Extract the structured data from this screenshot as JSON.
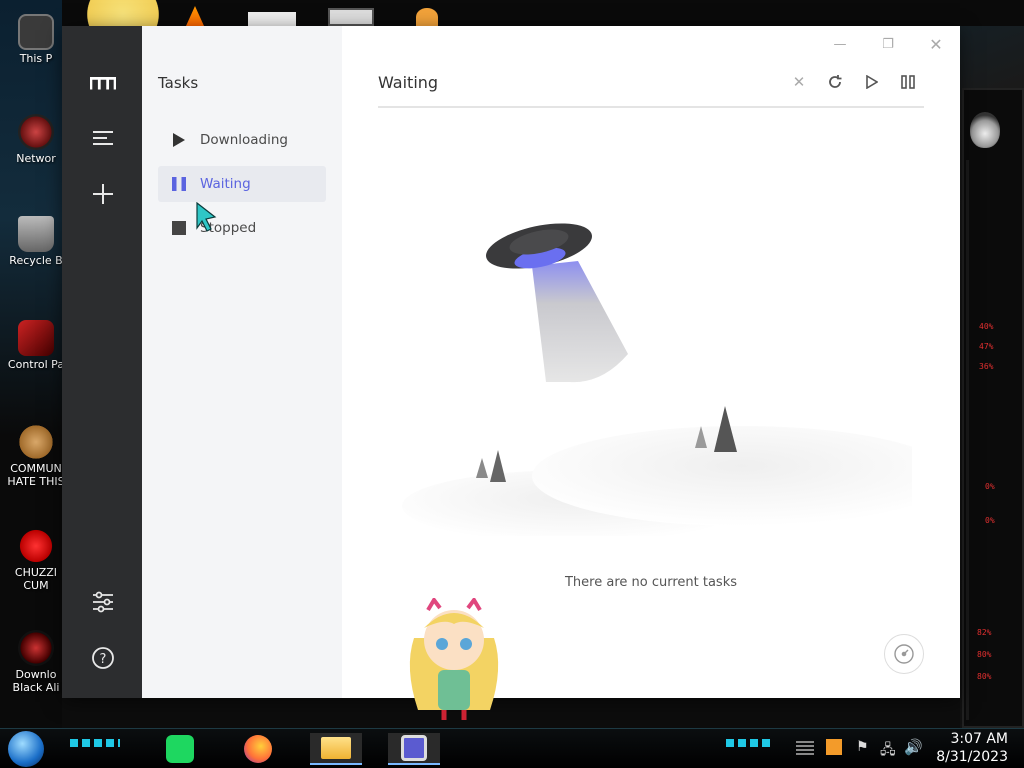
{
  "desktop": {
    "icons": [
      {
        "label": "This P",
        "icon": "computer-icon"
      },
      {
        "label": "Networ",
        "icon": "network-icon"
      },
      {
        "label": "Recycle B",
        "icon": "recycle-bin-icon"
      },
      {
        "label": "Control Pa",
        "icon": "control-panel-icon"
      },
      {
        "label": "COMMUN HATE THIS",
        "icon": "money-bag-icon"
      },
      {
        "label": "CHUZZI CUM",
        "icon": "chuzzle-icon"
      },
      {
        "label": "Downlo Black Ali",
        "icon": "alienware-icon"
      }
    ],
    "gauges": [
      "40%",
      "47%",
      "36%",
      "0%",
      "0%",
      "82%",
      "80%",
      "80%"
    ]
  },
  "app": {
    "rail": {
      "logo": "motrix-logo-icon",
      "items": [
        "menu-icon",
        "plus-icon",
        "preferences-icon",
        "help-icon"
      ]
    },
    "sidebar": {
      "title": "Tasks",
      "items": [
        {
          "label": "Downloading",
          "icon": "play-icon",
          "active": false
        },
        {
          "label": "Waiting",
          "icon": "pause-icon",
          "active": true
        },
        {
          "label": "Stopped",
          "icon": "stop-icon",
          "active": false
        }
      ]
    },
    "main": {
      "title": "Waiting",
      "toolbar": [
        "clear-icon",
        "refresh-icon",
        "resume-all-icon",
        "pause-all-icon"
      ],
      "empty_text": "There are no current tasks"
    },
    "window_controls": [
      "minimize-icon",
      "maximize-icon",
      "close-icon"
    ],
    "accent": "#5b64e0"
  },
  "taskbar": {
    "apps": [
      "spotify-icon",
      "firefox-icon",
      "file-explorer-icon",
      "app-icon"
    ],
    "time": "3:07 AM",
    "date": "8/31/2023"
  }
}
